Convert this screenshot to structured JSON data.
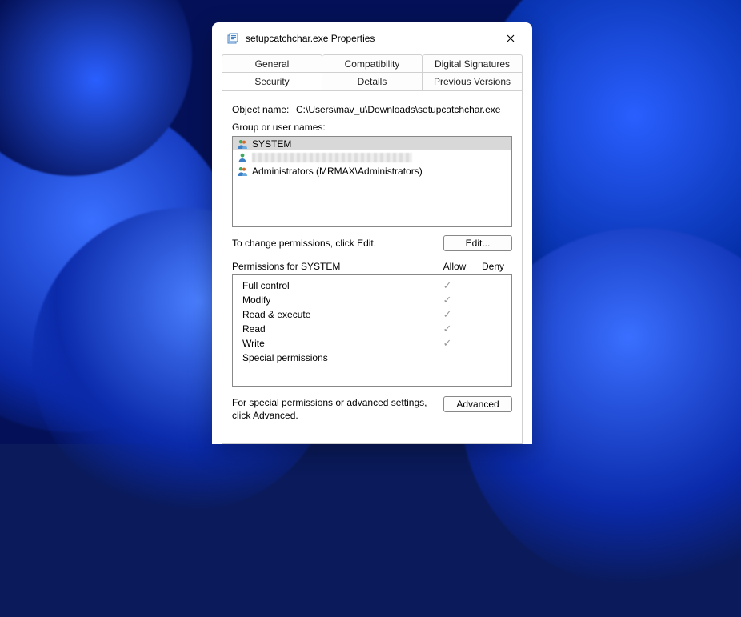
{
  "window": {
    "title": "setupcatchchar.exe Properties"
  },
  "tabs": {
    "row1": [
      "General",
      "Compatibility",
      "Digital Signatures"
    ],
    "row2": [
      "Security",
      "Details",
      "Previous Versions"
    ],
    "active": "Security"
  },
  "object": {
    "label": "Object name:",
    "path": "C:\\Users\\mav_u\\Downloads\\setupcatchchar.exe"
  },
  "groupLabel": "Group or user names:",
  "users": [
    {
      "name": "SYSTEM",
      "redacted": false,
      "selected": true
    },
    {
      "name": "",
      "redacted": true,
      "selected": false
    },
    {
      "name": "Administrators (MRMAX\\Administrators)",
      "redacted": false,
      "selected": false
    }
  ],
  "editHint": "To change permissions, click Edit.",
  "editBtn": "Edit...",
  "permHeader": {
    "name": "Permissions for SYSTEM",
    "allow": "Allow",
    "deny": "Deny"
  },
  "perms": [
    {
      "name": "Full control",
      "allow": true,
      "deny": false
    },
    {
      "name": "Modify",
      "allow": true,
      "deny": false
    },
    {
      "name": "Read & execute",
      "allow": true,
      "deny": false
    },
    {
      "name": "Read",
      "allow": true,
      "deny": false
    },
    {
      "name": "Write",
      "allow": true,
      "deny": false
    },
    {
      "name": "Special permissions",
      "allow": false,
      "deny": false
    }
  ],
  "advHint": "For special permissions or advanced settings, click Advanced.",
  "advBtn": "Advanced"
}
